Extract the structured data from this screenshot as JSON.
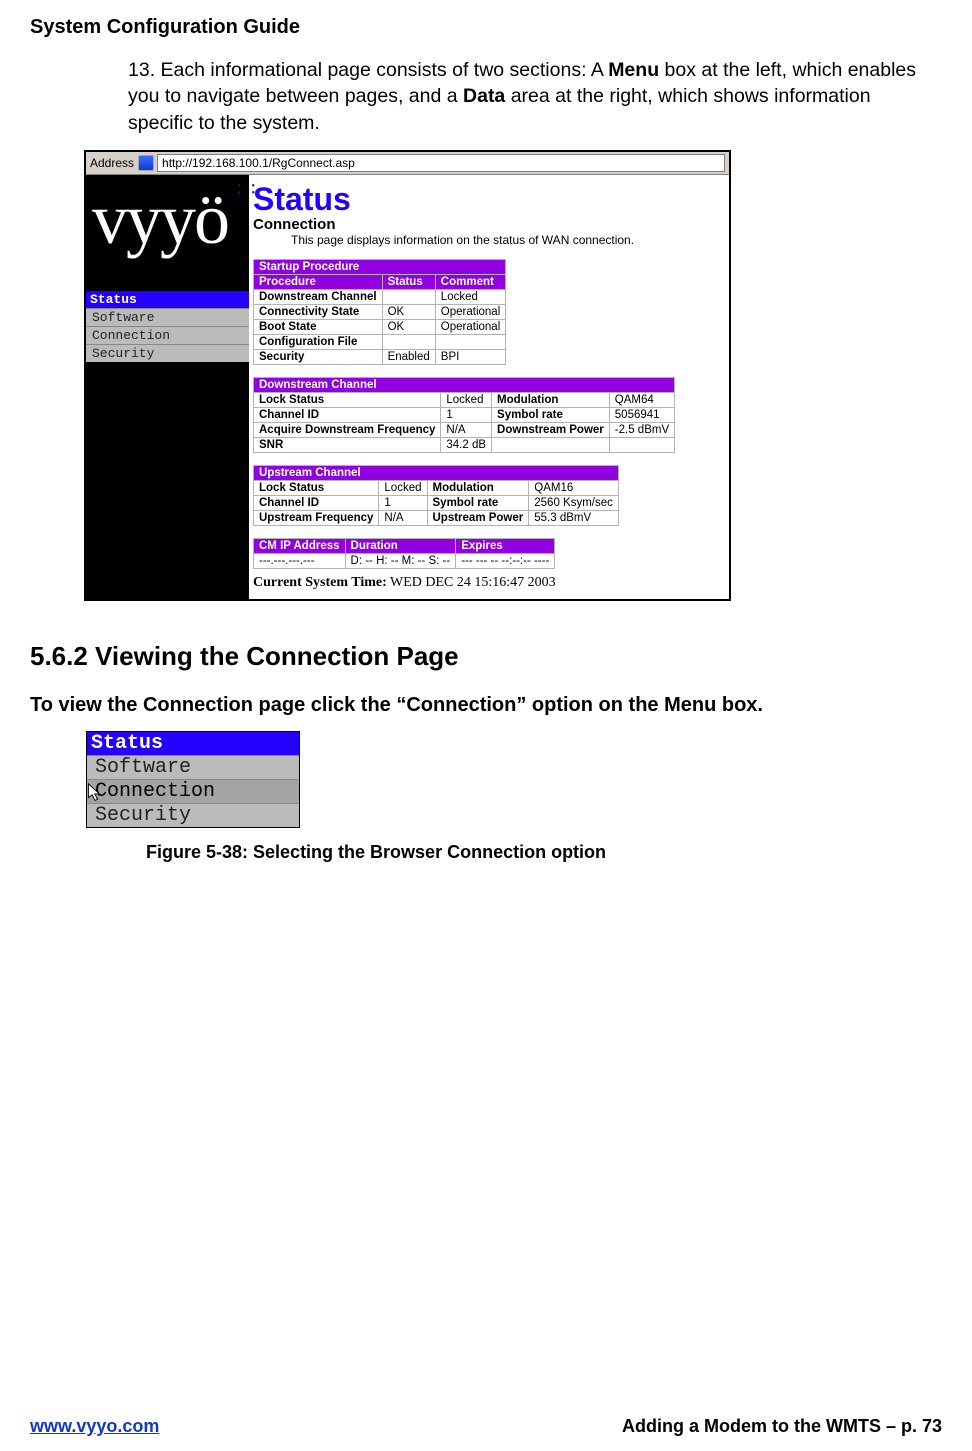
{
  "doc": {
    "title": "System Configuration Guide",
    "para_prefix": "13. Each informational page consists of two sections: A ",
    "para_bold1": "Menu",
    "para_mid": " box at the left, which enables you to navigate between pages, and a ",
    "para_bold2": "Data",
    "para_suffix": " area at the right, which shows information specific to the system."
  },
  "fig1": {
    "address_label": "Address",
    "url": "http://192.168.100.1/RgConnect.asp",
    "logo": "vyyö",
    "menu": {
      "header": "Status",
      "items": [
        "Software",
        "Connection",
        "Security"
      ]
    },
    "statusTitle": "Status",
    "connectionHead": "Connection",
    "connectionSub": "This page displays information on the status of WAN connection.",
    "startup": {
      "section": "Startup Procedure",
      "cols": [
        "Procedure",
        "Status",
        "Comment"
      ],
      "rows": [
        {
          "p": "Downstream Channel",
          "s": "",
          "c": "Locked"
        },
        {
          "p": "Connectivity State",
          "s": "OK",
          "c": "Operational"
        },
        {
          "p": "Boot State",
          "s": "OK",
          "c": "Operational"
        },
        {
          "p": "Configuration File",
          "s": "",
          "c": ""
        },
        {
          "p": "Security",
          "s": "Enabled",
          "c": "BPI"
        }
      ]
    },
    "downstream": {
      "section": "Downstream Channel",
      "rows": [
        {
          "l": "Lock Status",
          "v": "Locked",
          "l2": "Modulation",
          "v2": "QAM64"
        },
        {
          "l": "Channel ID",
          "v": "1",
          "l2": "Symbol rate",
          "v2": "5056941"
        },
        {
          "l": "Acquire Downstream Frequency",
          "v": "N/A",
          "l2": "Downstream Power",
          "v2": "-2.5 dBmV"
        },
        {
          "l": "SNR",
          "v": "34.2 dB",
          "l2": "",
          "v2": ""
        }
      ]
    },
    "upstream": {
      "section": "Upstream Channel",
      "rows": [
        {
          "l": "Lock Status",
          "v": "Locked",
          "l2": "Modulation",
          "v2": "QAM16"
        },
        {
          "l": "Channel ID",
          "v": "1",
          "l2": "Symbol rate",
          "v2": "2560 Ksym/sec"
        },
        {
          "l": "Upstream Frequency",
          "v": "N/A",
          "l2": "Upstream Power",
          "v2": "55.3 dBmV"
        }
      ]
    },
    "lease": {
      "cols": [
        "CM IP Address",
        "Duration",
        "Expires"
      ],
      "row": [
        "---.---.---.---",
        "D: -- H: -- M: -- S: --",
        "--- --- -- --:--:-- ----"
      ]
    },
    "systime_label": "Current System Time:",
    "systime_value": " WED DEC 24 15:16:47 2003"
  },
  "section": {
    "num_title": "5.6.2 Viewing the Connection Page",
    "instruction": "To view the Connection page click the “Connection” option on the Menu box."
  },
  "fig2": {
    "header": "Status",
    "items": [
      "Software",
      "Connection",
      "Security"
    ],
    "caption": "Figure 5-38: Selecting the Browser Connection option"
  },
  "footer": {
    "left": "www.vyyo.com",
    "right": "Adding a Modem to the WMTS – p. 73"
  }
}
